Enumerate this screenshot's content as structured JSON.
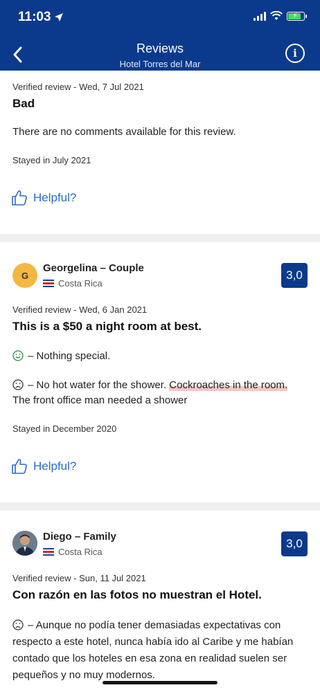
{
  "status_bar": {
    "time": "11:03"
  },
  "header": {
    "title": "Reviews",
    "subtitle": "Hotel Torres del Mar",
    "info_label": "i"
  },
  "reviews": [
    {
      "meta": "Verified review - Wed, 7 Jul 2021",
      "title": "Bad",
      "body": "There are no comments available for this review.",
      "stayed": "Stayed in July 2021",
      "helpful": "Helpful?"
    },
    {
      "avatar_letter": "G",
      "name": "Georgelina – Couple",
      "country": "Costa Rica",
      "score": "3,0",
      "meta": "Verified review - Wed, 6 Jan 2021",
      "title": "This is a $50 a night room at best.",
      "positive": "– Nothing special.",
      "negative_prefix": "– No hot water for the shower. ",
      "negative_highlight": "Cockroaches in the room.",
      "negative_suffix": " The front office man needed a shower",
      "stayed": "Stayed in December 2020",
      "helpful": "Helpful?"
    },
    {
      "name": "Diego – Family",
      "country": "Costa Rica",
      "score": "3,0",
      "meta": "Verified review - Sun, 11 Jul 2021",
      "title": "Con razón en las fotos no muestran el Hotel.",
      "negative": "– Aunque no podía tener demasiadas expectativas con respecto a este hotel, nunca había ido al Caribe y me habían contado que los hoteles en esa zona en realidad suelen ser pequeños y no muy modernos."
    }
  ]
}
